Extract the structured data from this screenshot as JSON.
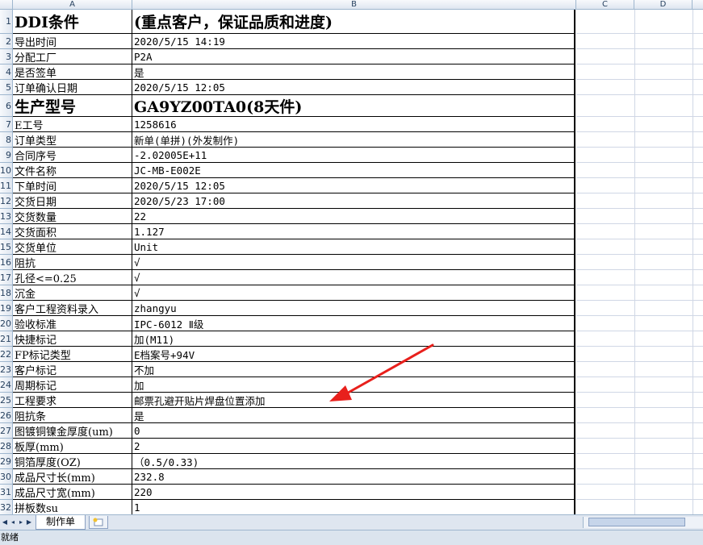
{
  "columns": [
    {
      "label": "A"
    },
    {
      "label": "B"
    },
    {
      "label": "C"
    },
    {
      "label": "D"
    }
  ],
  "rows": [
    {
      "num": "1",
      "a": "DDI条件",
      "b": "(重点客户，保证品质和进度)",
      "big": true
    },
    {
      "num": "2",
      "a": "导出时间",
      "b": "2020/5/15 14:19"
    },
    {
      "num": "3",
      "a": "分配工厂",
      "b": "P2A"
    },
    {
      "num": "4",
      "a": "是否签单",
      "b": "是"
    },
    {
      "num": "5",
      "a": "订单确认日期",
      "b": "2020/5/15 12:05"
    },
    {
      "num": "6",
      "a": "生产型号",
      "b": "GA9YZ00TA0(8天件)",
      "big": true
    },
    {
      "num": "7",
      "a": "E工号",
      "b": "1258616"
    },
    {
      "num": "8",
      "a": "订单类型",
      "b": "新单(单拼)(外发制作)"
    },
    {
      "num": "9",
      "a": "合同序号",
      "b": "-2.02005E+11"
    },
    {
      "num": "10",
      "a": "文件名称",
      "b": "JC-MB-E002E"
    },
    {
      "num": "11",
      "a": "下单时间",
      "b": "2020/5/15 12:05"
    },
    {
      "num": "12",
      "a": "交货日期",
      "b": "2020/5/23 17:00"
    },
    {
      "num": "13",
      "a": "交货数量",
      "b": "22"
    },
    {
      "num": "14",
      "a": "交货面积",
      "b": "1.127"
    },
    {
      "num": "15",
      "a": "交货单位",
      "b": "Unit"
    },
    {
      "num": "16",
      "a": "阻抗",
      "b": "√"
    },
    {
      "num": "17",
      "a": "孔径<=0.25",
      "b": "√"
    },
    {
      "num": "18",
      "a": "沉金",
      "b": "√"
    },
    {
      "num": "19",
      "a": "客户工程资料录入",
      "b": "zhangyu"
    },
    {
      "num": "20",
      "a": "验收标准",
      "b": "IPC-6012 Ⅱ级"
    },
    {
      "num": "21",
      "a": "快捷标记",
      "b": "加(M11)"
    },
    {
      "num": "22",
      "a": "FP标记类型",
      "b": "E档案号+94V"
    },
    {
      "num": "23",
      "a": "客户标记",
      "b": "不加"
    },
    {
      "num": "24",
      "a": "周期标记",
      "b": "加"
    },
    {
      "num": "25",
      "a": "工程要求",
      "b": "邮票孔避开贴片焊盘位置添加"
    },
    {
      "num": "26",
      "a": "阻抗条",
      "b": "是"
    },
    {
      "num": "27",
      "a": "图镀铜镍金厚度(um)",
      "b": "0"
    },
    {
      "num": "28",
      "a": "板厚(mm)",
      "b": "2"
    },
    {
      "num": "29",
      "a": "铜箔厚度(OZ)",
      "b": "（0.5/0.33)"
    },
    {
      "num": "30",
      "a": "成品尺寸长(mm)",
      "b": "232.8"
    },
    {
      "num": "31",
      "a": "成品尺寸宽(mm)",
      "b": "220"
    },
    {
      "num": "32",
      "a": "拼板数su",
      "b": "1"
    }
  ],
  "sheet_tabs": [
    {
      "label": "制作单",
      "active": true
    }
  ],
  "status": {
    "text": "就绪"
  },
  "annotation": {
    "color": "#e8201c",
    "icon": "red-arrow-icon"
  },
  "colors": {
    "header_bg": "#dfe6f0",
    "grid": "#d0d7e5",
    "header_text": "#27415f"
  }
}
